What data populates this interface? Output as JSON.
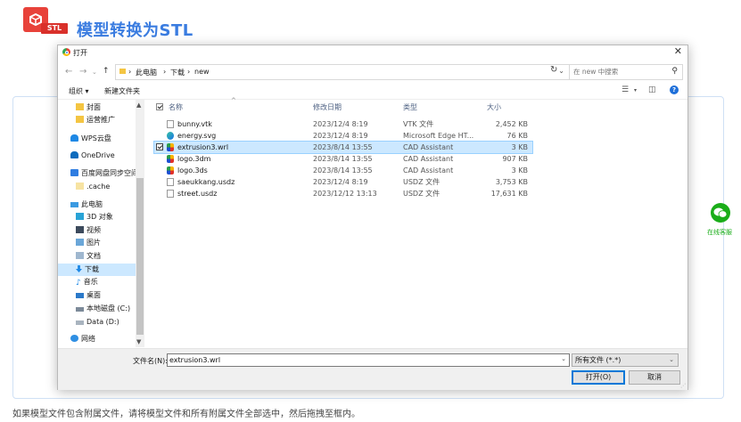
{
  "page": {
    "logo_tag": "STL",
    "title": "模型转换为STL",
    "hint": "如果模型文件包含附属文件，请将模型文件和所有附属文件全部选中，然后拖拽至框内。",
    "wechat_label": "在线客服"
  },
  "dialog": {
    "title": "打开",
    "close_icon": "close-icon",
    "path": [
      "此电脑",
      "下载",
      "new"
    ],
    "search_placeholder": "在 new 中搜索",
    "toolbar": {
      "organize": "组织 ▾",
      "new_folder": "新建文件夹"
    },
    "nav_items": [
      {
        "label": "封面",
        "icon": "folder-icon"
      },
      {
        "label": "运营推广",
        "icon": "folder-icon"
      },
      {
        "label": "WPS云盘",
        "icon": "cloud-icon"
      },
      {
        "label": "OneDrive",
        "icon": "cloud-icon"
      },
      {
        "label": "百度网盘同步空间",
        "icon": "baidu-icon"
      },
      {
        "label": ".cache",
        "icon": "folder-icon"
      },
      {
        "label": "此电脑",
        "icon": "computer-icon"
      },
      {
        "label": "3D 对象",
        "icon": "3d-objects-icon"
      },
      {
        "label": "视频",
        "icon": "video-icon"
      },
      {
        "label": "图片",
        "icon": "picture-icon"
      },
      {
        "label": "文档",
        "icon": "document-icon"
      },
      {
        "label": "下载",
        "icon": "download-icon",
        "selected": true
      },
      {
        "label": "音乐",
        "icon": "music-icon"
      },
      {
        "label": "桌面",
        "icon": "desktop-icon"
      },
      {
        "label": "本地磁盘 (C:)",
        "icon": "drive-icon"
      },
      {
        "label": "Data (D:)",
        "icon": "drive-icon"
      },
      {
        "label": "网络",
        "icon": "network-icon"
      }
    ],
    "columns": {
      "name": "名称",
      "date": "修改日期",
      "type": "类型",
      "size": "大小"
    },
    "files": [
      {
        "name": "bunny.vtk",
        "date": "2023/12/4 8:19",
        "type": "VTK 文件",
        "size": "2,452 KB",
        "icon": "doc"
      },
      {
        "name": "energy.svg",
        "date": "2023/12/4 8:19",
        "type": "Microsoft Edge HT...",
        "size": "76 KB",
        "icon": "edge"
      },
      {
        "name": "extrusion3.wrl",
        "date": "2023/8/14 13:55",
        "type": "CAD Assistant",
        "size": "3 KB",
        "icon": "cad",
        "selected": true
      },
      {
        "name": "logo.3dm",
        "date": "2023/8/14 13:55",
        "type": "CAD Assistant",
        "size": "907 KB",
        "icon": "cad"
      },
      {
        "name": "logo.3ds",
        "date": "2023/8/14 13:55",
        "type": "CAD Assistant",
        "size": "3 KB",
        "icon": "cad"
      },
      {
        "name": "saeukkang.usdz",
        "date": "2023/12/4 8:19",
        "type": "USDZ 文件",
        "size": "3,753 KB",
        "icon": "doc"
      },
      {
        "name": "street.usdz",
        "date": "2023/12/12 13:13",
        "type": "USDZ 文件",
        "size": "17,631 KB",
        "icon": "doc"
      }
    ],
    "filename_label": "文件名(N):",
    "filename_value": "extrusion3.wrl",
    "filter": "所有文件 (*.*)",
    "open_button": "打开(O)",
    "cancel_button": "取消"
  },
  "colors": {
    "accent": "#3a7ce0",
    "brand_red": "#e8423a",
    "selection": "#cce8ff",
    "wechat_green": "#1aad19"
  }
}
